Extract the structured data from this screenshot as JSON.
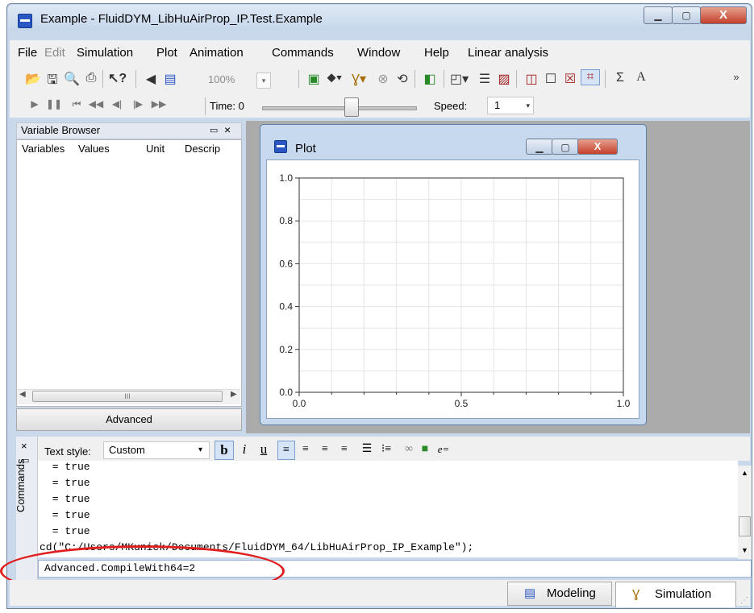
{
  "window": {
    "title": "Example - FluidDYM_LibHuAirProp_IP.Test.Example",
    "min_label": "▁",
    "max_label": "▢",
    "close_label": "X"
  },
  "menu": {
    "items": [
      "File",
      "Edit",
      "Simulation",
      "Plot",
      "Animation",
      "Commands",
      "Window",
      "Help",
      "Linear analysis"
    ]
  },
  "toolbar": {
    "zoom_value": "100%",
    "time_label": "Time:",
    "time_value": "0",
    "speed_label": "Speed:",
    "speed_value": "1",
    "overflow_label": "»"
  },
  "variable_browser": {
    "title": "Variable Browser",
    "columns": [
      "Variables",
      "Values",
      "Unit",
      "Descrip"
    ],
    "scroll_thumb": "III",
    "advanced_label": "Advanced"
  },
  "plot_window": {
    "title": "Plot"
  },
  "chart_data": {
    "type": "line",
    "series": [],
    "xlim": [
      0.0,
      1.0
    ],
    "ylim": [
      0.0,
      1.0
    ],
    "x_ticks": [
      "0.0",
      "0.5",
      "1.0"
    ],
    "y_ticks": [
      "0.0",
      "0.2",
      "0.4",
      "0.6",
      "0.8",
      "1.0"
    ],
    "grid": true,
    "title": "",
    "xlabel": "",
    "ylabel": ""
  },
  "commands": {
    "panel_label": "Commands",
    "text_style_label": "Text style:",
    "text_style_value": "Custom",
    "output_lines": [
      " = true",
      " = true",
      " = true",
      " = true",
      " = true",
      "cd(\"C:/Users/MKunick/Documents/FluidDYM_64/LibHuAirProp_IP_Example\");"
    ],
    "input_value": "Advanced.CompileWith64=2"
  },
  "mode_tabs": {
    "modeling_label": "Modeling",
    "simulation_label": "Simulation"
  },
  "colors": {
    "highlight": "#e01e1e",
    "window_frame": "#c9d8ea",
    "mdi_background": "#ababab"
  }
}
